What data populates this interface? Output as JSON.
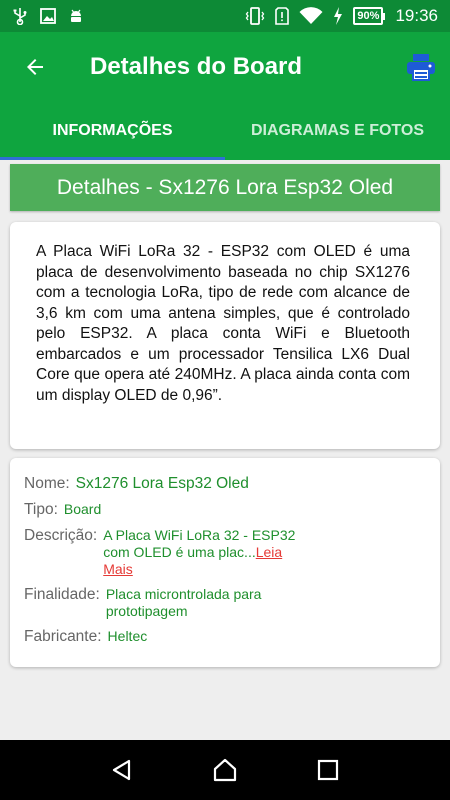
{
  "status_bar": {
    "battery": "90%",
    "time": "19:36",
    "icons": [
      "usb-icon",
      "image-icon",
      "android-icon",
      "vibrate-icon",
      "alert-icon",
      "wifi-icon",
      "charging-icon",
      "battery-icon"
    ]
  },
  "app_bar": {
    "title": "Detalhes do Board",
    "back_icon": "arrow-back-icon",
    "print_icon": "printer-icon"
  },
  "tabs": [
    {
      "label": "INFORMAÇÕES",
      "active": true
    },
    {
      "label": "DIAGRAMAS E FOTOS",
      "active": false
    }
  ],
  "section": {
    "title": "Detalhes - Sx1276 Lora Esp32 Oled"
  },
  "description": {
    "text": "A Placa WiFi LoRa 32 - ESP32 com OLED é uma placa de desenvolvimento baseada no chip SX1276 com a tecnologia LoRa, tipo de rede com alcance de 3,6 km com uma antena simples, que é controlado pelo ESP32. A placa conta WiFi e Bluetooth embarcados e um processador Tensilica LX6 Dual Core que opera até 240MHz. A placa ainda conta com um display OLED de 0,96”."
  },
  "info": {
    "nome_label": "Nome:",
    "nome_value": "Sx1276 Lora Esp32 Oled",
    "tipo_label": "Tipo:",
    "tipo_value": "Board",
    "descricao_label": "Descrição:",
    "descricao_value": "A Placa WiFi LoRa 32 - ESP32 com OLED é uma plac...",
    "read_more": "Leia Mais",
    "finalidade_label": "Finalidade:",
    "finalidade_value": "Placa microntrolada para prototipagem",
    "fabricante_label": "Fabricante:",
    "fabricante_value": "Heltec"
  },
  "colors": {
    "status_bar": "#0d8a36",
    "app_bar": "#0fa53f",
    "section_header": "#4fae5a",
    "value_text": "#1f8f2d",
    "link": "#e53935",
    "tab_indicator": "#2f6fd6",
    "print_icon": "#1e5bd6"
  }
}
